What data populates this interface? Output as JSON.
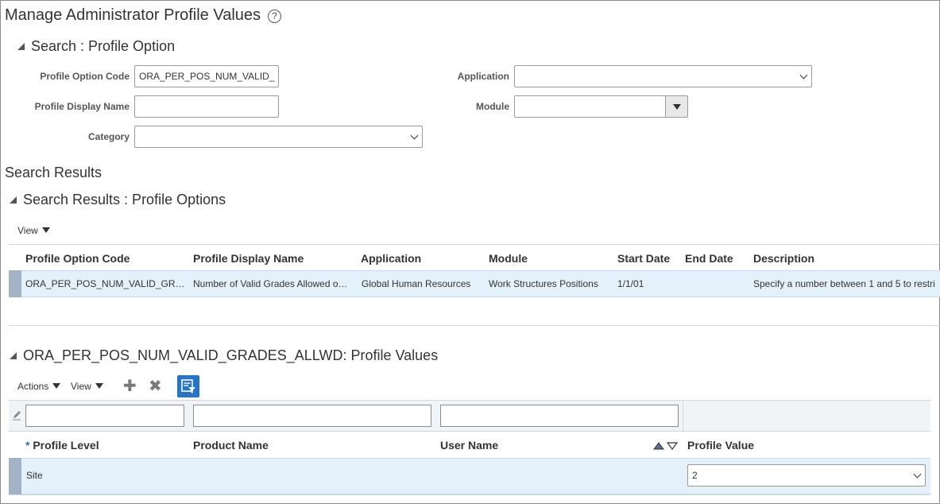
{
  "page": {
    "title": "Manage Administrator Profile Values",
    "help_glyph": "?"
  },
  "search": {
    "heading": "Search : Profile Option",
    "fields": {
      "profile_option_code_label": "Profile Option Code",
      "profile_option_code_value": "ORA_PER_POS_NUM_VALID_",
      "profile_display_name_label": "Profile Display Name",
      "profile_display_name_value": "",
      "category_label": "Category",
      "category_value": "",
      "application_label": "Application",
      "application_value": "",
      "module_label": "Module",
      "module_value": ""
    }
  },
  "results": {
    "heading": "Search Results",
    "panel_heading": "Search Results : Profile Options",
    "view_label": "View",
    "columns": [
      "Profile Option Code",
      "Profile Display Name",
      "Application",
      "Module",
      "Start Date",
      "End Date",
      "Description"
    ],
    "rows": [
      {
        "code": "ORA_PER_POS_NUM_VALID_GR…",
        "display_name": "Number of Valid Grades Allowed o…",
        "application": "Global Human Resources",
        "module": "Work Structures Positions",
        "start_date": "1/1/01",
        "end_date": "",
        "description": "Specify a number between 1 and 5 to restri"
      }
    ]
  },
  "values": {
    "heading": "ORA_PER_POS_NUM_VALID_GRADES_ALLWD: Profile Values",
    "actions_label": "Actions",
    "view_label": "View",
    "add_glyph": "✚",
    "delete_glyph": "✖",
    "required_mark": "*",
    "columns": {
      "profile_level": "Profile Level",
      "product_name": "Product Name",
      "user_name": "User Name",
      "profile_value": "Profile Value"
    },
    "rows": [
      {
        "profile_level": "Site",
        "product_name": "",
        "user_name": "",
        "profile_value": "2"
      }
    ]
  },
  "colors": {
    "accent": "#2774c7",
    "selected_row": "#e4f1fb",
    "row_marker": "#a3b3c6"
  }
}
